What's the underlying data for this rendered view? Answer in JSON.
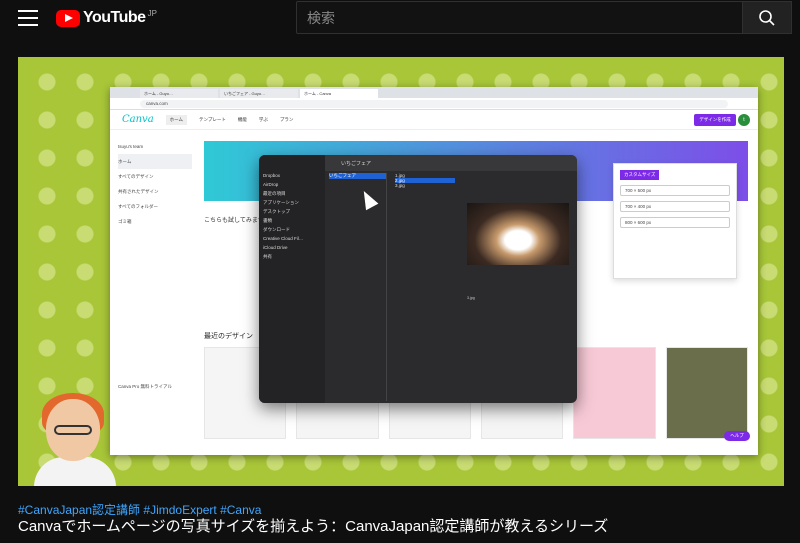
{
  "header": {
    "logo_text": "YouTube",
    "logo_region": "JP",
    "search_placeholder": "検索"
  },
  "video": {
    "tags": "#CanvaJapan認定講師 #JimdoExpert #Canva",
    "title": "Canvaでホームページの写真サイズを揃えよう：CanvaJapan認定講師が教えるシリーズ"
  },
  "screen": {
    "tabs": [
      "ホーム - Guyo…",
      "いちごフェア - Guyo…",
      "ホーム - Canva"
    ],
    "address": "canva.com",
    "canva_logo": "Canva",
    "nav": [
      "ホーム",
      "テンプレート",
      "機能",
      "学ぶ",
      "プラン"
    ],
    "create_button": "デザインを作成",
    "avatar_letter": "t",
    "team_name": "tsuyu's team",
    "sidebar": [
      "ホーム",
      "すべてのデザイン",
      "共有されたデザイン",
      "すべてのフォルダー",
      "ゴミ箱"
    ],
    "section_try": "こちらも試してみませんか？",
    "section_recent": "最近のデザイン",
    "finder_title": "いちごフェア",
    "finder_sidebar": [
      "Dropbox",
      "AirDrop",
      "最近の項目",
      "アプリケーション",
      "デスクトップ",
      "書類",
      "ダウンロード",
      "Creative Cloud Fil…",
      "iCloud Drive",
      "共有"
    ],
    "finder_files": [
      "1.jpg",
      "2.jpg",
      "3.jpg"
    ],
    "size_panel_button": "カスタムサイズ",
    "size_presets": [
      "700 × 500 px",
      "700 × 400 px",
      "800 × 600 px"
    ],
    "help_button": "ヘルプ",
    "pro_trial": "Canva Pro 無料トライアル"
  }
}
